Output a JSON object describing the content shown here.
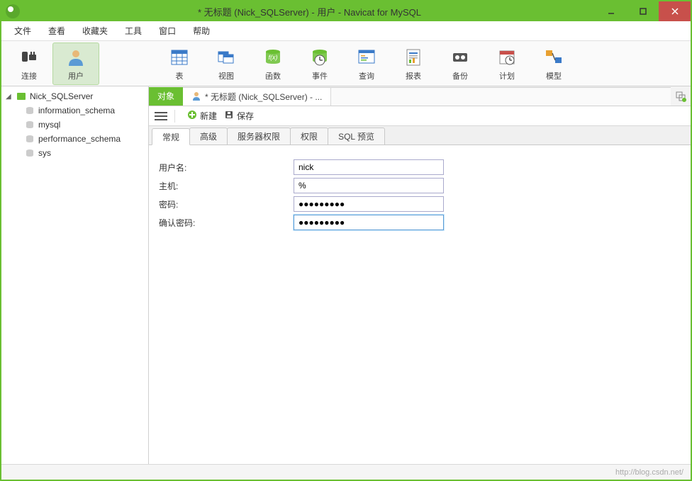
{
  "title": "* 无标题 (Nick_SQLServer) - 用户 - Navicat for MySQL",
  "menu": [
    "文件",
    "查看",
    "收藏夹",
    "工具",
    "窗口",
    "帮助"
  ],
  "toolbar": [
    {
      "name": "connection",
      "label": "连接"
    },
    {
      "name": "user",
      "label": "用户",
      "active": true
    },
    {
      "name": "table",
      "label": "表"
    },
    {
      "name": "view",
      "label": "视图"
    },
    {
      "name": "function",
      "label": "函数"
    },
    {
      "name": "event",
      "label": "事件"
    },
    {
      "name": "query",
      "label": "查询"
    },
    {
      "name": "report",
      "label": "报表"
    },
    {
      "name": "backup",
      "label": "备份"
    },
    {
      "name": "schedule",
      "label": "计划"
    },
    {
      "name": "model",
      "label": "模型"
    }
  ],
  "tree": {
    "root": "Nick_SQLServer",
    "children": [
      "information_schema",
      "mysql",
      "performance_schema",
      "sys"
    ]
  },
  "doc_tabs": [
    {
      "label": "对象",
      "kind": "green"
    },
    {
      "label": "* 无标题 (Nick_SQLServer) - ...",
      "kind": "active"
    }
  ],
  "actions": {
    "new": "新建",
    "save": "保存"
  },
  "subtabs": [
    "常规",
    "高级",
    "服务器权限",
    "权限",
    "SQL 预览"
  ],
  "form": {
    "username_label": "用户名:",
    "username": "nick",
    "host_label": "主机:",
    "host": "%",
    "password_label": "密码:",
    "password": "●●●●●●●●●",
    "confirm_label": "确认密码:",
    "confirm": "●●●●●●●●●"
  },
  "footer_url": "http://blog.csdn.net/"
}
